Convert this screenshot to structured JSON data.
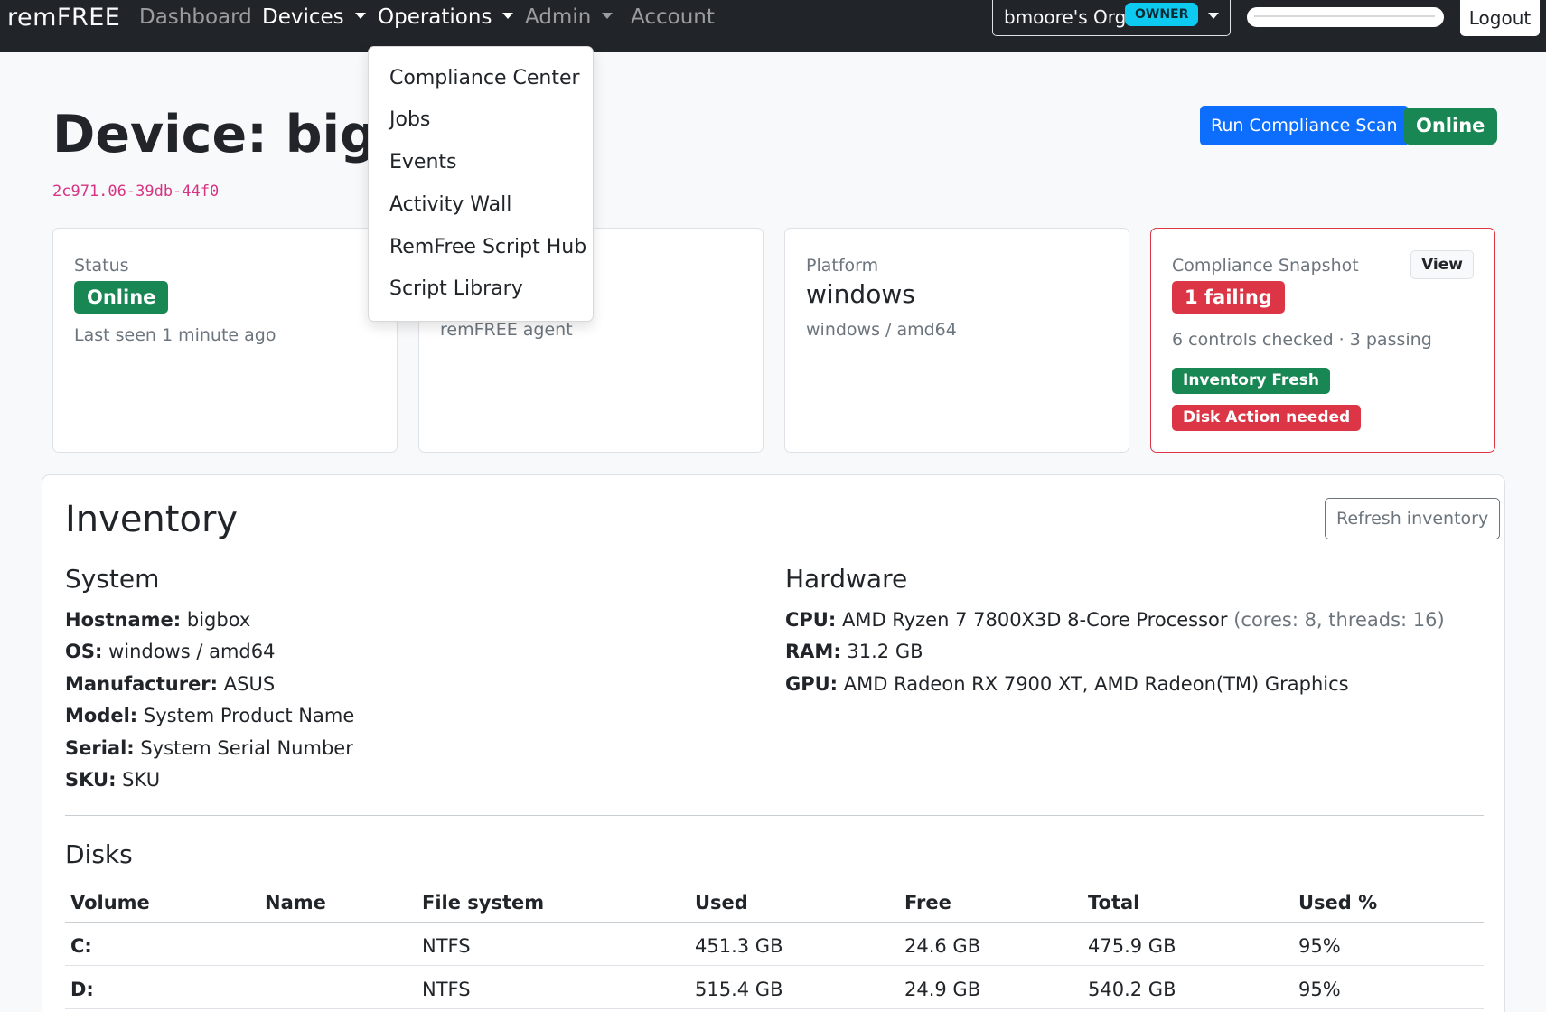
{
  "nav": {
    "brand": "remFREE",
    "items": [
      {
        "label": "Dashboard"
      },
      {
        "label": "Devices"
      },
      {
        "label": "Operations"
      },
      {
        "label": "Admin"
      },
      {
        "label": "Account"
      }
    ],
    "org_name": "bmoore's Org",
    "org_role": "OWNER",
    "logout_label": "Logout"
  },
  "operations_menu": {
    "items": [
      {
        "label": "Compliance Center"
      },
      {
        "label": "Jobs"
      },
      {
        "label": "Events"
      },
      {
        "label": "Activity Wall"
      },
      {
        "label": "RemFree Script Hub"
      },
      {
        "label": "Script Library"
      }
    ]
  },
  "header": {
    "title": "Device: bigbox",
    "device_id": "2c971.06-39db-44f0",
    "run_scan_label": "Run Compliance Scan",
    "status_badge": "Online"
  },
  "cards": {
    "status": {
      "label": "Status",
      "badge": "Online",
      "sub": "Last seen 1 minute ago"
    },
    "agent": {
      "sub": "remFREE agent"
    },
    "platform": {
      "label": "Platform",
      "value": "windows",
      "sub": "windows / amd64"
    },
    "compliance": {
      "label": "Compliance Snapshot",
      "view_label": "View",
      "badge": "1 failing",
      "sub": "6 controls checked · 3 passing",
      "tags": [
        {
          "label": "Inventory Fresh",
          "color": "#198754"
        },
        {
          "label": "Disk Action needed",
          "color": "#dc3545"
        }
      ]
    }
  },
  "inventory": {
    "title": "Inventory",
    "refresh_label": "Refresh inventory",
    "system": {
      "heading": "System",
      "fields": [
        {
          "key": "Hostname:",
          "value": "bigbox"
        },
        {
          "key": "OS:",
          "value": "windows / amd64"
        },
        {
          "key": "Manufacturer:",
          "value": "ASUS"
        },
        {
          "key": "Model:",
          "value": "System Product Name"
        },
        {
          "key": "Serial:",
          "value": "System Serial Number"
        },
        {
          "key": "SKU:",
          "value": "SKU"
        }
      ]
    },
    "hardware": {
      "heading": "Hardware",
      "cpu_key": "CPU:",
      "cpu_value": "AMD Ryzen 7 7800X3D 8-Core Processor",
      "cpu_detail": "(cores: 8, threads: 16)",
      "ram_key": "RAM:",
      "ram_value": "31.2 GB",
      "gpu_key": "GPU:",
      "gpu_value": "AMD Radeon RX 7900 XT, AMD Radeon(TM) Graphics"
    },
    "disks": {
      "heading": "Disks",
      "columns": [
        "Volume",
        "Name",
        "File system",
        "Used",
        "Free",
        "Total",
        "Used %"
      ],
      "rows": [
        {
          "volume": "C:",
          "name": "",
          "fs": "NTFS",
          "used": "451.3 GB",
          "free": "24.6 GB",
          "total": "475.9 GB",
          "pct": "95%"
        },
        {
          "volume": "D:",
          "name": "",
          "fs": "NTFS",
          "used": "515.4 GB",
          "free": "24.9 GB",
          "total": "540.2 GB",
          "pct": "95%"
        }
      ]
    }
  },
  "colors": {
    "navbar": "#212529",
    "primary": "#0d6efd",
    "success": "#198754",
    "danger": "#dc3545",
    "info": "#0dcaf0",
    "device_id": "#d63384"
  }
}
